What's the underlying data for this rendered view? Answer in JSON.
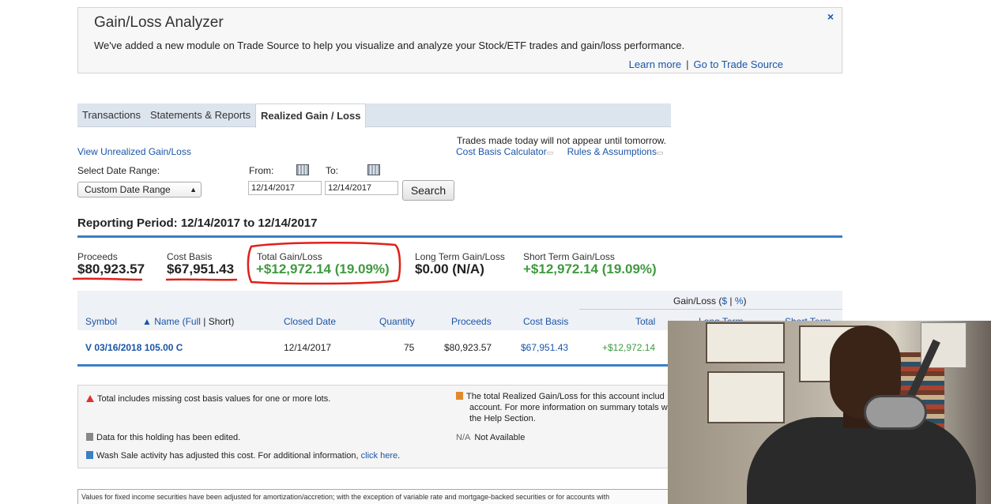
{
  "banner": {
    "title": "Gain/Loss Analyzer",
    "text": "We've added a new module on Trade Source to help you visualize and analyze your Stock/ETF trades and gain/loss performance.",
    "learn_more": "Learn more",
    "separator": "|",
    "go_to": "Go to Trade Source",
    "close": "×"
  },
  "tabs": [
    {
      "label": "Transactions"
    },
    {
      "label": "Statements & Reports"
    },
    {
      "label": "Realized Gain / Loss"
    }
  ],
  "links": {
    "view_unrealized": "View Unrealized Gain/Loss",
    "trades_note": "Trades made today will not appear until tomorrow.",
    "cost_basis_calc": "Cost Basis Calculator",
    "rules": "Rules & Assumptions"
  },
  "filters": {
    "date_range_label": "Select Date Range:",
    "date_range_value": "Custom Date Range",
    "from_label": "From:",
    "to_label": "To:",
    "from_value": "12/14/2017",
    "to_value": "12/14/2017",
    "search": "Search"
  },
  "period": "Reporting Period: 12/14/2017 to 12/14/2017",
  "summary": {
    "proceeds_label": "Proceeds",
    "proceeds_value": "$80,923.57",
    "cost_label": "Cost Basis",
    "cost_value": "$67,951.43",
    "total_label": "Total Gain/Loss",
    "total_value": "+$12,972.14 (19.09%)",
    "long_label": "Long Term Gain/Loss",
    "long_value": "$0.00 (N/A)",
    "short_label": "Short Term Gain/Loss",
    "short_value": "+$12,972.14 (19.09%)"
  },
  "table": {
    "gainloss_header": "Gain/Loss ($ | %)",
    "gl_prefix": "Gain/Loss (",
    "gl_dollar": "$",
    "gl_sep": " | ",
    "gl_pct": "%",
    "gl_suffix": ")",
    "headers": {
      "symbol": "Symbol",
      "name": "▲ Name",
      "name_full": "(Full",
      "name_sep": "|",
      "name_short": "Short)",
      "closed_date": "Closed Date",
      "quantity": "Quantity",
      "proceeds": "Proceeds",
      "cost_basis": "Cost Basis",
      "total": "Total",
      "long_term": "Long Term",
      "short_term": "Short Term"
    },
    "rows": [
      {
        "symbol": "V 03/16/2018 105.00 C",
        "closed_date": "12/14/2017",
        "quantity": "75",
        "proceeds": "$80,923.57",
        "cost_basis": "$67,951.43",
        "total": "+$12,972.14"
      }
    ]
  },
  "notes": {
    "missing": "Total includes missing cost basis values for one or more lots.",
    "edited": "Data for this holding has been edited.",
    "wash": "Wash Sale activity has adjusted this cost. For additional information,",
    "click_here": "click here",
    "period_mark": ".",
    "realized_1": "The total Realized Gain/Loss for this account includ",
    "realized_2": "account. For more information on summary totals w",
    "realized_3": "the Help Section.",
    "na_code": "N/A",
    "na_text": "Not Available"
  },
  "footer": "Values for fixed income securities have been adjusted for amortization/accretion; with the exception of variable rate and mortgage-backed securities or for accounts with",
  "colors": {
    "link": "#1a55a8",
    "gain": "#3f9a3f",
    "rule": "#3b7fc4",
    "annotation": "#e0201a"
  }
}
